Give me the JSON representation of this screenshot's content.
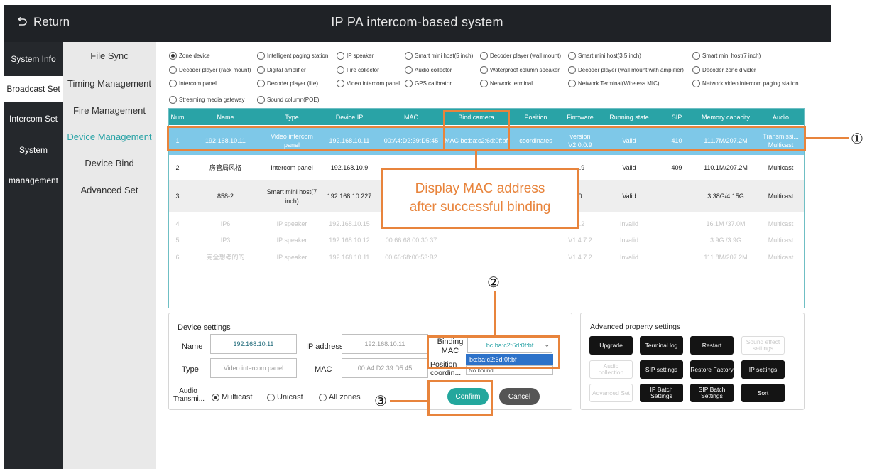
{
  "header": {
    "return_label": "Return",
    "title": "IP PA intercom-based system"
  },
  "left_nav": [
    "System Info",
    "Broadcast Set",
    "Intercom Set",
    "System",
    "management"
  ],
  "sub_nav": [
    "File Sync",
    "Timing Management",
    "Fire Management",
    "Device Management",
    "Device Bind",
    "Advanced Set"
  ],
  "device_types": [
    "Zone device",
    "Intelligent paging station",
    "IP speaker",
    "Smart mini host(5 inch)",
    "Decoder player (wall mount)",
    "Smart mini host(3.5 inch)",
    "Smart mini host(7 inch)",
    "Decoder player (rack mount)",
    "Digital amplifier",
    "Fire collector",
    "Audio collector",
    "Waterproof column speaker",
    "Decoder player (wall mount with amplifier)",
    "Decoder zone divider",
    "Intercom panel",
    "Decoder player (lite)",
    "Video intercom panel",
    "GPS calibrator",
    "Network terminal",
    "Network Terminal(Wireless MIC)",
    "Network video intercom paging station",
    "Streaming media gateway",
    "Sound column(POE)"
  ],
  "table": {
    "columns": [
      "Num",
      "Name",
      "Type",
      "Device IP",
      "MAC",
      "Bind camera",
      "Position",
      "Firmware",
      "Running state",
      "SIP",
      "Memory capacity",
      "Audio"
    ],
    "rows": [
      {
        "num": "1",
        "name": "192.168.10.11",
        "type": "Video intercom panel",
        "ip": "192.168.10.11",
        "mac": "00:A4:D2:39:D5:45",
        "camera": "MAC bc:ba:c2:6d:0f:bf",
        "position": "coordinates",
        "firmware": "version V2.0.0.9",
        "state": "Valid",
        "sip": "410",
        "memory": "111.7M/207.2M",
        "audio": "Transmissi... Multicast"
      },
      {
        "num": "2",
        "name": "房管局风格",
        "type": "Intercom panel",
        "ip": "192.168.10.9",
        "mac": "",
        "camera": "",
        "position": "",
        "firmware": "...9",
        "state": "Valid",
        "sip": "409",
        "memory": "110.1M/207.2M",
        "audio": "Multicast"
      },
      {
        "num": "3",
        "name": "858-2",
        "type": "Smart mini host(7 inch)",
        "ip": "192.168.10.227",
        "mac": "",
        "camera": "",
        "position": "",
        "firmware": "0",
        "state": "Valid",
        "sip": "",
        "memory": "3.38G/4.15G",
        "audio": "Multicast"
      },
      {
        "num": "4",
        "name": "IP6",
        "type": "IP speaker",
        "ip": "192.168.10.15",
        "mac": "",
        "camera": "",
        "position": "",
        "firmware": "...2",
        "state": "Invalid",
        "sip": "",
        "memory": "16.1M /37.0M",
        "audio": "Multicast"
      },
      {
        "num": "5",
        "name": "IP3",
        "type": "IP speaker",
        "ip": "192.168.10.12",
        "mac": "00:66:68:00:30:37",
        "camera": "",
        "position": "",
        "firmware": "V1.4.7.2",
        "state": "Invalid",
        "sip": "",
        "memory": "3.9G /3.9G",
        "audio": "Multicast"
      },
      {
        "num": "6",
        "name": "完全想考的的",
        "type": "IP speaker",
        "ip": "192.168.10.11",
        "mac": "00:66:68:00:53:B2",
        "camera": "",
        "position": "",
        "firmware": "V1.4.7.2",
        "state": "Invalid",
        "sip": "",
        "memory": "111.8M/207.2M",
        "audio": "Multicast"
      }
    ]
  },
  "callout": {
    "line1": "Display MAC address",
    "line2": "after successful binding"
  },
  "markers": {
    "m1": "①",
    "m2": "②",
    "m3": "③"
  },
  "device_settings": {
    "title": "Device settings",
    "name_label": "Name",
    "name_value": "192.168.10.11",
    "ip_label": "IP address",
    "ip_value": "192.168.10.11",
    "binding_label": "Binding MAC",
    "binding_value": "bc:ba:c2:6d:0f:bf",
    "dropdown_options": [
      "bc:ba:c2:6d:0f:bf",
      "No bound"
    ],
    "type_label": "Type",
    "type_value": "Video intercom panel",
    "mac_label": "MAC",
    "mac_value": "00:A4:D2:39:D5:45",
    "position_label": "Position coordin...",
    "audio_label": "Audio Transmi...",
    "audio_options": [
      "Multicast",
      "Unicast",
      "All zones"
    ],
    "confirm": "Confirm",
    "cancel": "Cancel"
  },
  "advanced": {
    "title": "Advanced property settings",
    "buttons": [
      "Upgrade",
      "Terminal log",
      "Restart",
      "Sound effect settings",
      "Audio collection",
      "SIP settings",
      "Restore Factory",
      "IP settings",
      "Advanced Set",
      "IP Batch Settings",
      "SIP Batch Settings",
      "Sort"
    ]
  },
  "colors": {
    "accent": "#29a3a6",
    "highlight_row": "#7ec8e8",
    "annotation": "#e8843c",
    "header_bg": "#1f2226"
  }
}
